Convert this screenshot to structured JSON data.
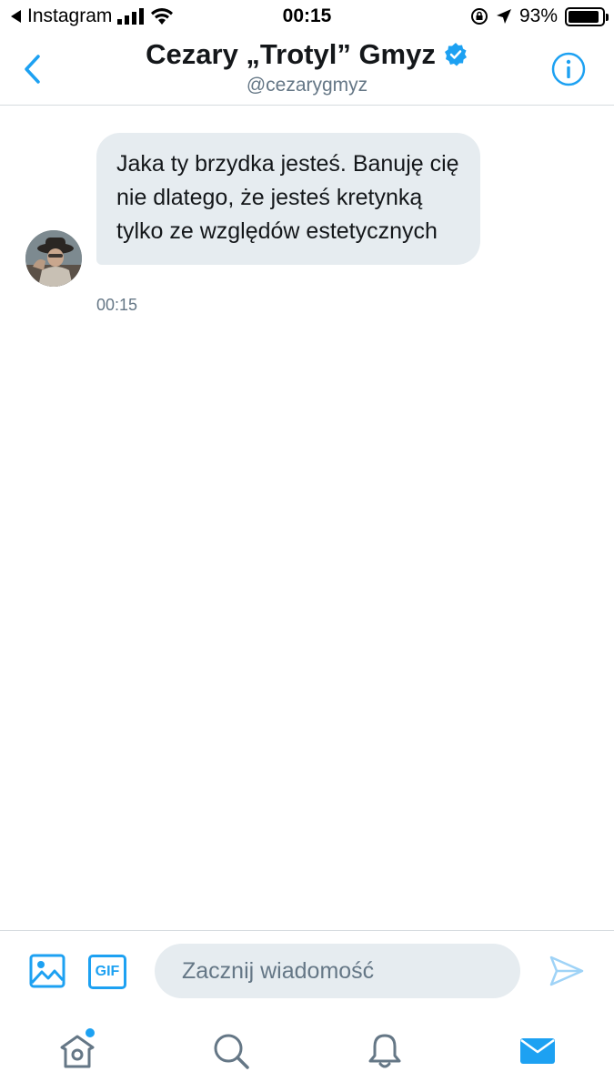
{
  "status_bar": {
    "back_app": "Instagram",
    "time": "00:15",
    "battery": "93%",
    "battery_level": 0.93
  },
  "header": {
    "name": "Cezary „Trotyl” Gmyz",
    "handle": "@cezarygmyz"
  },
  "conversation": {
    "messages": [
      {
        "text": "Jaka ty brzydka jesteś. Banuję cię nie dlatego, że jesteś kretynką tylko ze względów estetycznych",
        "time": "00:15"
      }
    ]
  },
  "composer": {
    "gif_label": "GIF",
    "placeholder": "Zacznij wiadomość"
  },
  "tabs": [
    "home-icon",
    "search-icon",
    "bell-icon",
    "mail-icon"
  ],
  "colors": {
    "accent": "#1da1f2",
    "bubble": "#e6ecf0",
    "secondary_text": "#657786"
  }
}
